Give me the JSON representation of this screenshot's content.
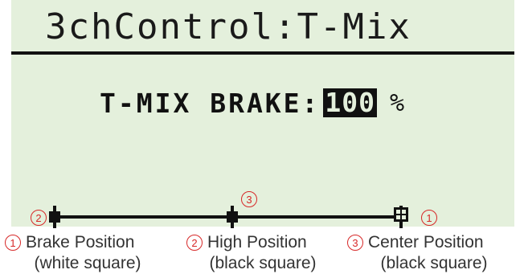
{
  "screen": {
    "title": "3chControl:T-Mix",
    "brake_label": "T-MIX BRAKE:",
    "brake_value": "100",
    "brake_unit": "%"
  },
  "markers": {
    "marker1": "1",
    "marker2": "2",
    "marker3": "3"
  },
  "legend": [
    {
      "number": "1",
      "label": "Brake Position",
      "sub": "(white square)"
    },
    {
      "number": "2",
      "label": "High Position",
      "sub": "(black square)"
    },
    {
      "number": "3",
      "label": "Center Position",
      "sub": "(black square)"
    }
  ],
  "colors": {
    "lcd_background": "#e4f0dc",
    "lcd_text": "#111111",
    "callout_red": "#d72828"
  }
}
